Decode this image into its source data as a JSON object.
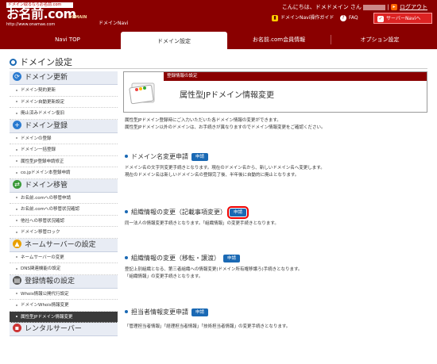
{
  "header": {
    "logo_tag": "ドメイン取るならお名前.com",
    "logo_main": "お名前.com",
    "logo_sub": "DOMAIN",
    "logo_url": "http://www.onamae.com",
    "app_name": "ドメインNavi",
    "greeting_prefix": "こんにちは、ドメドメイン さん",
    "logout_label": "ログアウト",
    "guide_label": "ドメインNavi操作ガイド",
    "faq_label": "FAQ",
    "navi_label": "サーバーNaviへ"
  },
  "tabs": [
    {
      "label": "Navi TOP"
    },
    {
      "label": "ドメイン設定"
    },
    {
      "label": "お名前.com会員情報"
    },
    {
      "label": "オプション設定"
    }
  ],
  "page_title": "ドメイン設定",
  "sidebar": {
    "sections": [
      {
        "title": "ドメイン更新",
        "items": [
          "ドメイン契約更新",
          "ドメイン自動更新設定",
          "廃止済みドメイン復旧"
        ]
      },
      {
        "title": "ドメイン登録",
        "items": [
          "ドメインの登録",
          "ドメイン一括登録",
          "属性型JP登録申請修正",
          "co.jpドメイン本登録申請"
        ]
      },
      {
        "title": "ドメイン移管",
        "items": [
          "お名前.comへの移管申請",
          "お名前.comへの移管状況確認",
          "他社への移管状況確認",
          "ドメイン移管ロック"
        ]
      },
      {
        "title": "ネームサーバーの設定",
        "items": [
          "ネームサーバーの変更",
          "DNS関連機能の設定"
        ]
      },
      {
        "title": "登録情報の設定",
        "items": [
          "Whois情報公開代行設定",
          "ドメインWhois情報変更",
          "属性型JPドメイン情報変更"
        ]
      },
      {
        "title": "レンタルサーバー",
        "items": []
      }
    ]
  },
  "banner": {
    "caption": "登録情報の設定",
    "title": "属性型JPドメイン情報変更"
  },
  "intro": [
    "属性型JPドメイン登録時にご入力いただいた各ドメイン情報の変更ができます。",
    "属性型JPドメイン以外のドメインは、お手続きが異なりますのでドメイン情報変更をご確認ください。"
  ],
  "apply_label": "申請",
  "sections": [
    {
      "title": "ドメイン名変更申請",
      "desc": [
        "ドメイン名の文字列変更手続きとなります。現在のドメイン名から、新しいドメイン名へ変更します。",
        "現在のドメイン名は新しいドメイン名の登録完了後、半年後に自動的に廃止となります。"
      ]
    },
    {
      "title": "組織情報の変更（記載事項変更）",
      "desc": [
        "同一法人の情報変更手続きとなります。「組織情報」の変更手続きとなります。"
      ]
    },
    {
      "title": "組織情報の変更（移転・譲渡）",
      "desc": [
        "登記上別組織となる、第三者組織への情報変更(ドメイン所有権移譲ろ)手続きとなります。",
        "「組織情報」の変更手続きとなります。"
      ]
    },
    {
      "title": "担当者情報変更申請",
      "desc": [
        "「管理担当者情報」「経理担当者情報」「技術担当者情報」の変更手続きとなります。"
      ]
    }
  ]
}
